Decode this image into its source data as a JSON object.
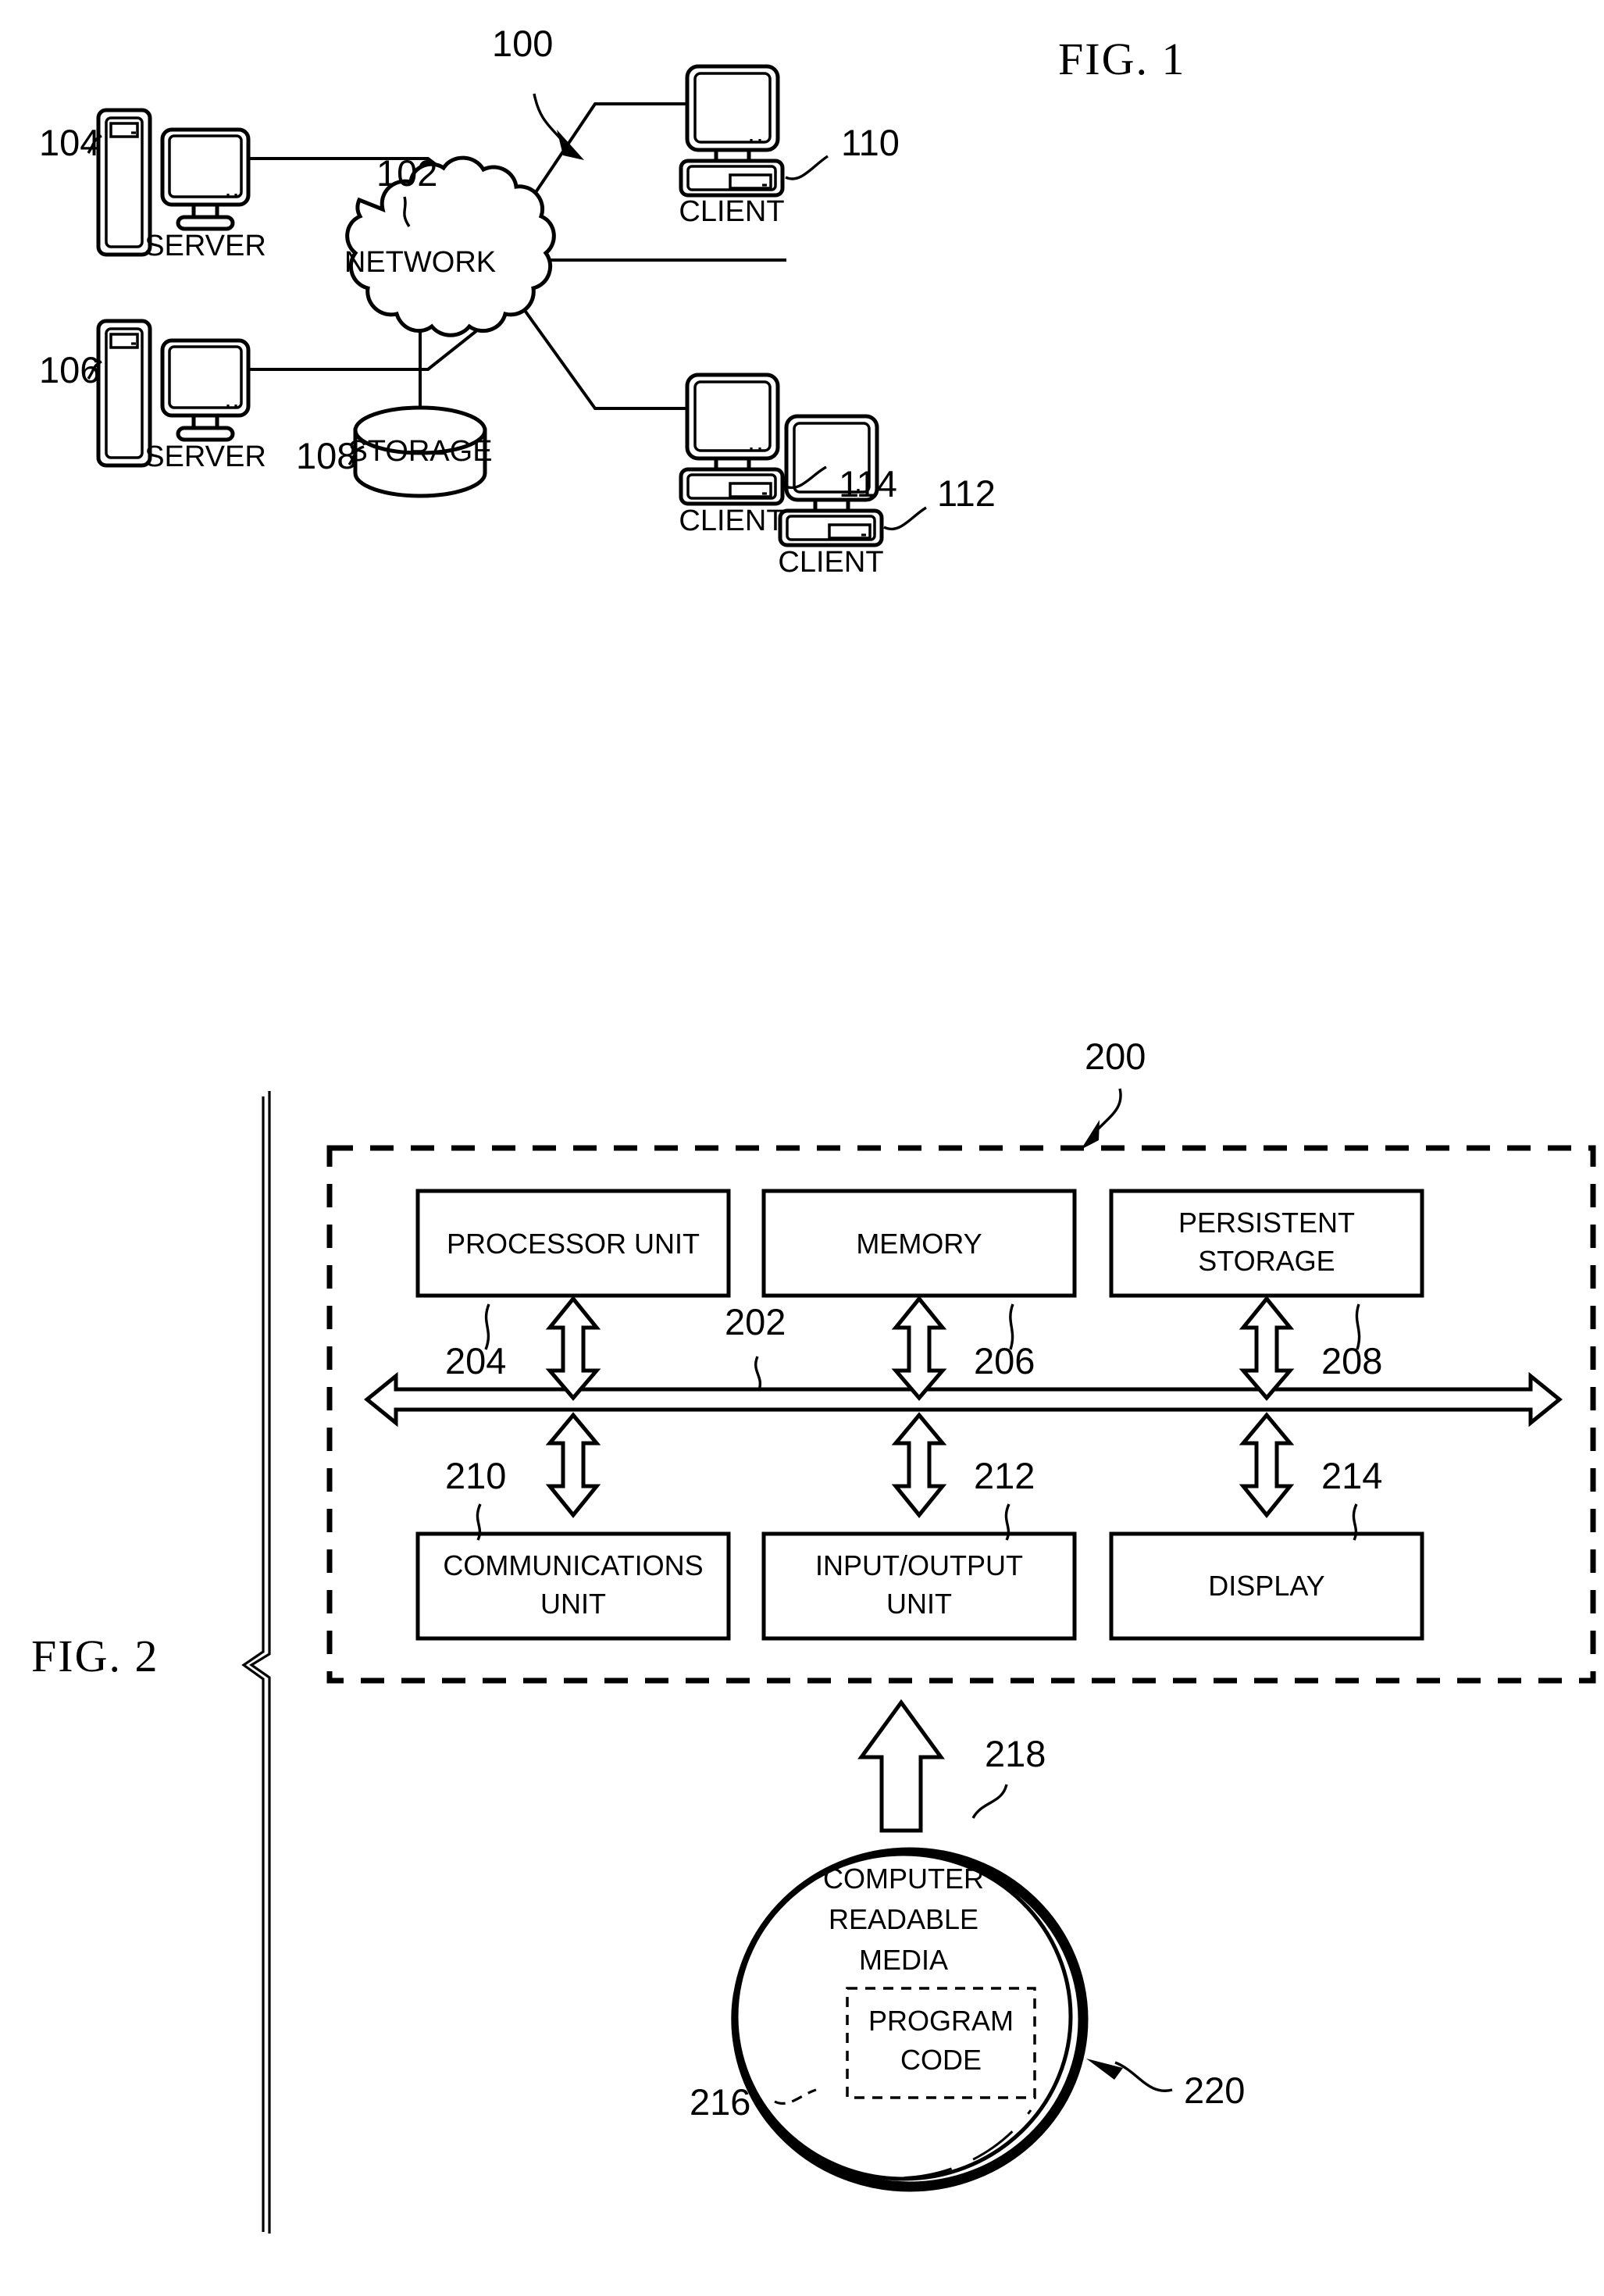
{
  "figures": [
    {
      "id": "fig1",
      "title": "FIG. 1",
      "diagram_number": "100",
      "nodes": {
        "network": {
          "label": "NETWORK",
          "ref": "102"
        },
        "server_top": {
          "label": "SERVER",
          "ref": "104"
        },
        "server_bottom": {
          "label": "SERVER",
          "ref": "106"
        },
        "storage": {
          "label": "STORAGE",
          "ref": "108"
        },
        "client_top": {
          "label": "CLIENT",
          "ref": "110"
        },
        "client_middle": {
          "label": "CLIENT",
          "ref": "112"
        },
        "client_bottom": {
          "label": "CLIENT",
          "ref": "114"
        }
      }
    },
    {
      "id": "fig2",
      "title": "FIG. 2",
      "diagram_number": "200",
      "bus": {
        "ref": "202"
      },
      "blocks": [
        {
          "label": "PROCESSOR UNIT",
          "ref": "204"
        },
        {
          "label": "MEMORY",
          "ref": "206"
        },
        {
          "label": "PERSISTENT\nSTORAGE",
          "line1": "PERSISTENT",
          "line2": "STORAGE",
          "ref": "208"
        },
        {
          "label": "COMMUNICATIONS\nUNIT",
          "line1": "COMMUNICATIONS",
          "line2": "UNIT",
          "ref": "210"
        },
        {
          "label": "INPUT/OUTPUT\nUNIT",
          "line1": "INPUT/OUTPUT",
          "line2": "UNIT",
          "ref": "212"
        },
        {
          "label": "DISPLAY",
          "ref": "214"
        }
      ],
      "media": {
        "line1": "COMPUTER",
        "line2": "READABLE",
        "line3": "MEDIA",
        "ref": "218",
        "disc_ref": "220",
        "program_code": {
          "line1": "PROGRAM",
          "line2": "CODE",
          "ref": "216"
        }
      }
    }
  ],
  "colors": {
    "ink": "#000000",
    "paper": "#ffffff"
  }
}
